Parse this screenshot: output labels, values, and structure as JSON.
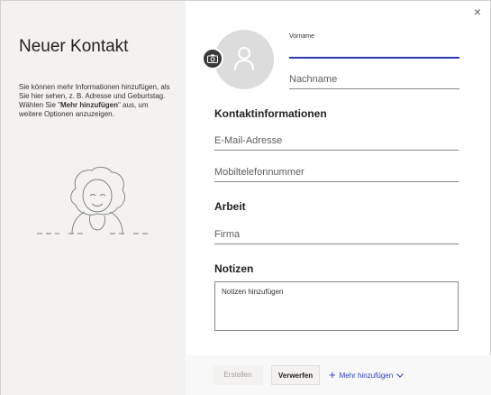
{
  "window": {
    "close_glyph": "×"
  },
  "sidebar": {
    "title": "Neuer Kontakt",
    "desc_part1": "Sie können mehr Informationen hinzufügen, als Sie hier sehen, z. B. Adresse und Geburtstag. Wählen Sie \"",
    "desc_bold": "Mehr hinzufügen",
    "desc_part2": "\" aus, um weitere Optionen anzuzeigen.",
    "illustration": "person-illustration"
  },
  "form": {
    "firstname_label": "Vorname",
    "firstname_value": "",
    "lastname_placeholder": "Nachname",
    "contact_section": "Kontaktinformationen",
    "email_placeholder": "E-Mail-Adresse",
    "mobile_placeholder": "Mobiltelefonnummer",
    "work_section": "Arbeit",
    "company_placeholder": "Firma",
    "notes_section": "Notizen",
    "notes_placeholder": "Notizen hinzufügen"
  },
  "icons": {
    "avatar": "person-icon",
    "camera": "camera-icon",
    "plus": "plus-icon",
    "chevron": "chevron-down-icon",
    "close": "close-icon"
  },
  "footer": {
    "create_label": "Erstellen",
    "discard_label": "Verwerfen",
    "more_label": "Mehr hinzufügen"
  },
  "colors": {
    "accent": "#2b3bb8",
    "sidebar_bg": "#f3f2f1"
  }
}
